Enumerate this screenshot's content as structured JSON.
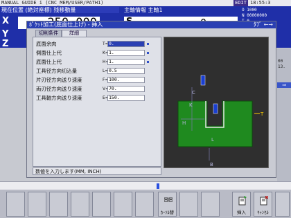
{
  "top_bar": {
    "path": "MANUAL GUIDE i (CNC_MEM/USER/PATH1)",
    "badge": "EDIT",
    "clock": "18:55:3"
  },
  "position_panel": {
    "header": "現在位置 (絶対座標)  残移動量",
    "axes": [
      "X",
      "Y",
      "Z"
    ],
    "x_value": "-250.000"
  },
  "spindle_panel": {
    "header": "主軸情報        主軸1",
    "letter": "S",
    "value": "0"
  },
  "info_panel": {
    "lines": [
      "O 1000",
      "N 00000000",
      "T 0"
    ]
  },
  "right_strip": {
    "nums": [
      "00",
      "13."
    ],
    "tab": "⇒"
  },
  "dialog": {
    "title": "ﾎﾟｹｯﾄ加工(底面仕上げ) - 挿入",
    "title_right": "ﾀﾌﾞ ←→",
    "tabs": [
      "切削条件",
      "詳細"
    ],
    "rows": [
      {
        "label": "底面余肉",
        "key": "T=",
        "value": "0."
      },
      {
        "label": "側面仕上代",
        "key": "K=",
        "value": "1."
      },
      {
        "label": "底面仕上代",
        "key": "H=",
        "value": "1."
      },
      {
        "label": "工具径方向切込量",
        "key": "L=",
        "value": "0.5"
      },
      {
        "label": "片刃径方向送り速度",
        "key": "F=",
        "value": "100."
      },
      {
        "label": "両刃径方向送り速度",
        "key": "V=",
        "value": "70."
      },
      {
        "label": "工具軸方向送り速度",
        "key": "E=",
        "value": "150."
      }
    ],
    "status": "数値を入力します(MM, INCH)",
    "diagram_labels": {
      "c": "C",
      "k": "K",
      "h": "H",
      "l": "L",
      "t": "T",
      "b": "B"
    }
  },
  "softkeys": [
    {
      "caption": ""
    },
    {
      "caption": ""
    },
    {
      "caption": ""
    },
    {
      "caption": ""
    },
    {
      "caption": ""
    },
    {
      "caption": ""
    },
    {
      "caption": ""
    },
    {
      "caption": "ｶｰｿﾙ替",
      "icon": "cursor-switch-icon"
    },
    {
      "caption": ""
    },
    {
      "caption": ""
    },
    {
      "caption": "挿入",
      "icon": "insert-icon"
    },
    {
      "caption": "ｷｬﾝｾﾙ",
      "icon": "cancel-icon"
    },
    {
      "caption": ""
    }
  ]
}
